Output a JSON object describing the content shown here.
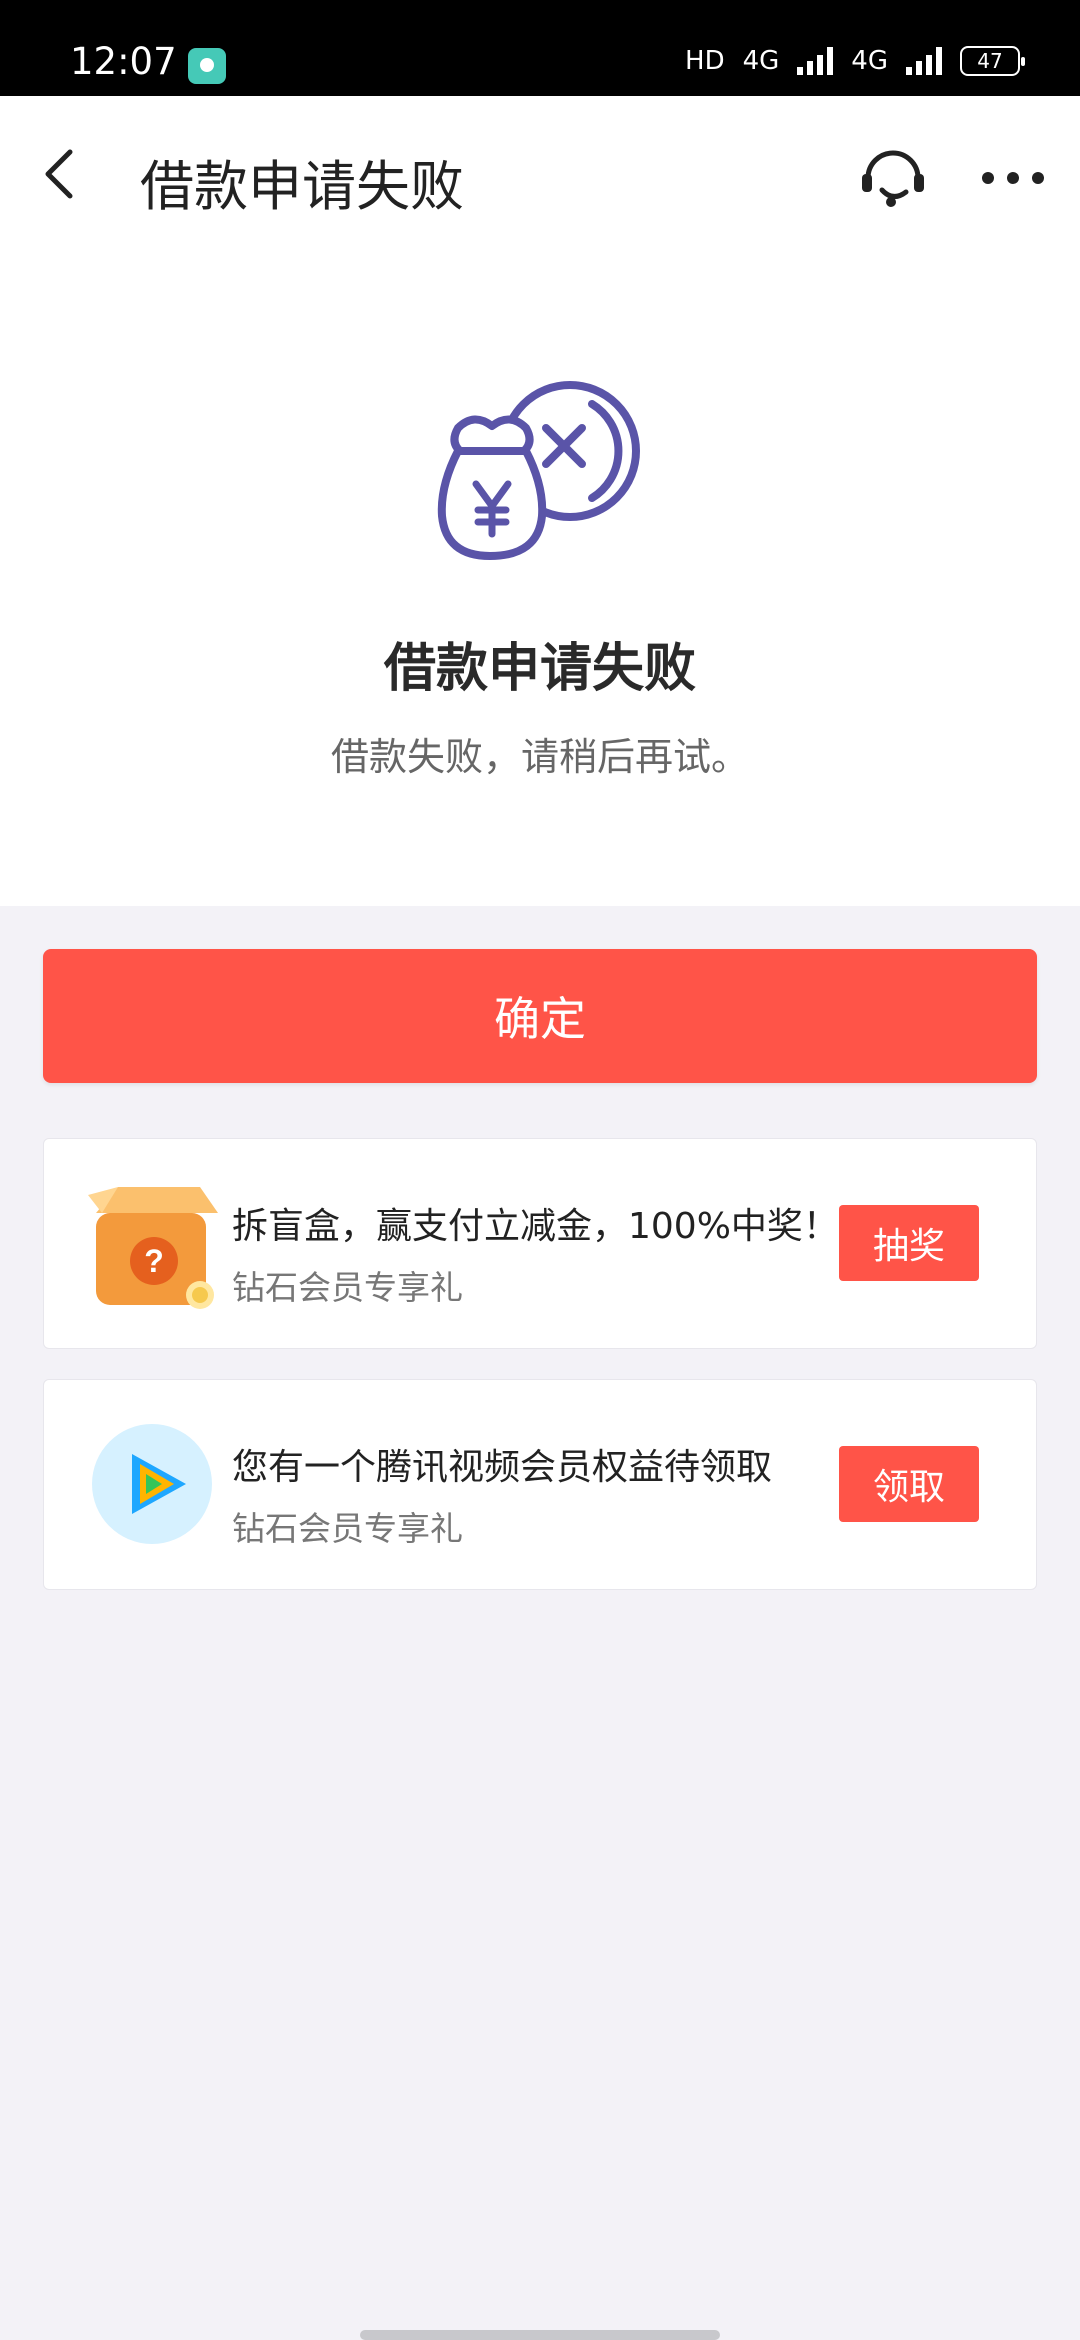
{
  "status_bar": {
    "time": "12:07",
    "network_hd": "HD",
    "network_1": "4G",
    "network_2": "4G",
    "battery": "47"
  },
  "navbar": {
    "title": "借款申请失败",
    "icons": [
      "back-arrow-icon",
      "customer-service-icon",
      "more-icon"
    ]
  },
  "result": {
    "icon": "money-bag-fail-icon",
    "title": "借款申请失败",
    "subtitle": "借款失败，请稍后再试。"
  },
  "confirm_button": "确定",
  "promos": [
    {
      "icon": "blind-box-icon",
      "title": "拆盲盒，赢支付立减金，100%中奖！",
      "subtitle": "钻石会员专享礼",
      "button": "抽奖"
    },
    {
      "icon": "tencent-video-icon",
      "title": "您有一个腾讯视频会员权益待领取",
      "subtitle": "钻石会员专享礼",
      "button": "领取"
    }
  ],
  "colors": {
    "accent": "#ff5448",
    "icon_purple": "#5a54a8",
    "background": "#f3f2f7"
  }
}
